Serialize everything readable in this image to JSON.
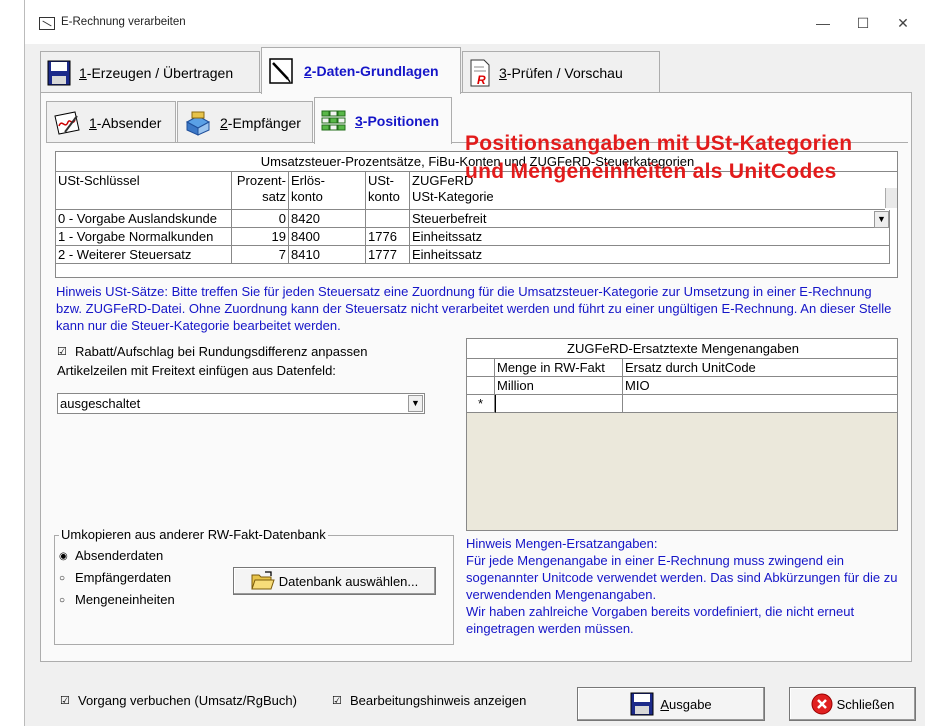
{
  "window": {
    "title": "E-Rechnung verarbeiten",
    "minimize": "—",
    "maximize": "☐",
    "close": "✕"
  },
  "main_tabs": [
    {
      "key": "1",
      "rest": "-Erzeugen / Übertragen",
      "icon": "floppy-disk-icon"
    },
    {
      "key": "2",
      "rest": "-Daten-Grundlagen",
      "icon": "edit-document-icon"
    },
    {
      "key": "3",
      "rest": "-Prüfen / Vorschau",
      "icon": "pdf-document-icon"
    }
  ],
  "sub_tabs": [
    {
      "key": "1",
      "rest": "-Absender",
      "icon": "signature-icon"
    },
    {
      "key": "2",
      "rest": "-Empfänger",
      "icon": "recipient-box-icon"
    },
    {
      "key": "3",
      "rest": "-Positionen",
      "icon": "grid-list-icon"
    }
  ],
  "vat_table": {
    "caption": "Umsatzsteuer-Prozentsätze, FiBu-Konten und ZUGFeRD-Steuerkategorien",
    "headers": {
      "key": "USt-Schlüssel",
      "rate_l1": "Prozent-",
      "rate_l2": "satz",
      "rev_l1": "Erlös-",
      "rev_l2": "konto",
      "vat_l1": "USt-",
      "vat_l2": "konto",
      "cat_l1": "ZUGFeRD",
      "cat_l2": "USt-Kategorie"
    },
    "rows": [
      {
        "key": "0 - Vorgabe Auslandskunde",
        "rate": "0",
        "rev": "8420",
        "vat": "",
        "cat": "Steuerbefreit"
      },
      {
        "key": "1 - Vorgabe Normalkunden",
        "rate": "19",
        "rev": "8400",
        "vat": "1776",
        "cat": "Einheitssatz"
      },
      {
        "key": "2 - Weiterer Steuersatz",
        "rate": "7",
        "rev": "8410",
        "vat": "1777",
        "cat": "Einheitssatz"
      }
    ]
  },
  "overlay_text": "Positionsangaben mit USt-Kategorien und Mengeneinheiten als UnitCodes",
  "hint_vat": "Hinweis USt-Sätze: Bitte treffen Sie für jeden Steuersatz eine Zuordnung für die Umsatzsteuer-Kategorie zur Umsetzung in einer E-Rechnung bzw. ZUGFeRD-Datei. Ohne Zuordnung kann der Steuersatz nicht verarbeitet werden und führt zu einer ungültigen E-Rechnung. An dieser Stelle kann nur die Steuer-Kategorie bearbeitet werden.",
  "options": {
    "rounding_checkbox": "Rabatt/Aufschlag bei Rundungsdifferenz anpassen",
    "rounding_checked": true,
    "freetext_label": "Artikelzeilen mit Freitext einfügen aus Datenfeld:",
    "freetext_value": "ausgeschaltet"
  },
  "unit_table": {
    "caption": "ZUGFeRD-Ersatztexte Mengenangaben",
    "col1": "Menge in RW-Fakt",
    "col2": "Ersatz durch UnitCode",
    "rows": [
      {
        "qty": "Million",
        "code": "MIO"
      }
    ],
    "new_row_marker": "*"
  },
  "copy_group": {
    "legend": "Umkopieren aus anderer RW-Fakt-Datenbank",
    "options": [
      "Absenderdaten",
      "Empfängerdaten",
      "Mengeneinheiten"
    ],
    "selected": 0,
    "button_label": "Datenbank auswählen..."
  },
  "hint_units": {
    "title": "Hinweis Mengen-Ersatzangaben:",
    "body": "Für jede Mengenangabe in einer E-Rechnung muss zwingend ein sogenannter Unitcode verwendet werden. Das sind Abkürzungen für die zu verwendenden Mengenangaben.",
    "more": "Wir haben zahlreiche Vorgaben bereits vordefiniert, die nicht erneut eingetragen werden müssen."
  },
  "footer": {
    "book_checkbox": "Vorgang verbuchen (Umsatz/RgBuch)",
    "book_checked": true,
    "hint_checkbox": "Bearbeitungshinweis anzeigen",
    "hint_checked": true,
    "output_key": "A",
    "output_rest": "usgabe",
    "close_label": "Schließen"
  },
  "colors": {
    "accent_blue": "#1515c8",
    "overlay_red": "#e21b1b",
    "grid_empty": "#ebe8db"
  }
}
